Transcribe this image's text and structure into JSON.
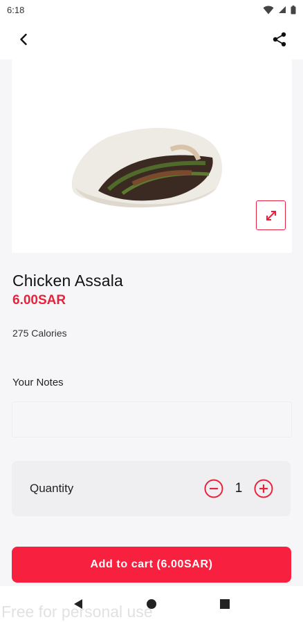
{
  "status_bar": {
    "time": "6:18"
  },
  "product": {
    "name": "Chicken Assala",
    "price": "6.00SAR",
    "calories": "275 Calories"
  },
  "notes": {
    "label": "Your Notes",
    "placeholder": ""
  },
  "quantity": {
    "label": "Quantity",
    "value": "1"
  },
  "cart": {
    "button_label": "Add to cart (6.00SAR)"
  },
  "watermark": "Free for personal use",
  "colors": {
    "accent": "#e8223b",
    "button": "#f7203f",
    "background": "#f6f5f7"
  },
  "icons": [
    "wifi-icon",
    "signal-icon",
    "battery-icon",
    "back-arrow-icon",
    "share-icon",
    "expand-icon",
    "minus-circle-icon",
    "plus-circle-icon",
    "nav-back-icon",
    "nav-home-icon",
    "nav-recents-icon"
  ]
}
